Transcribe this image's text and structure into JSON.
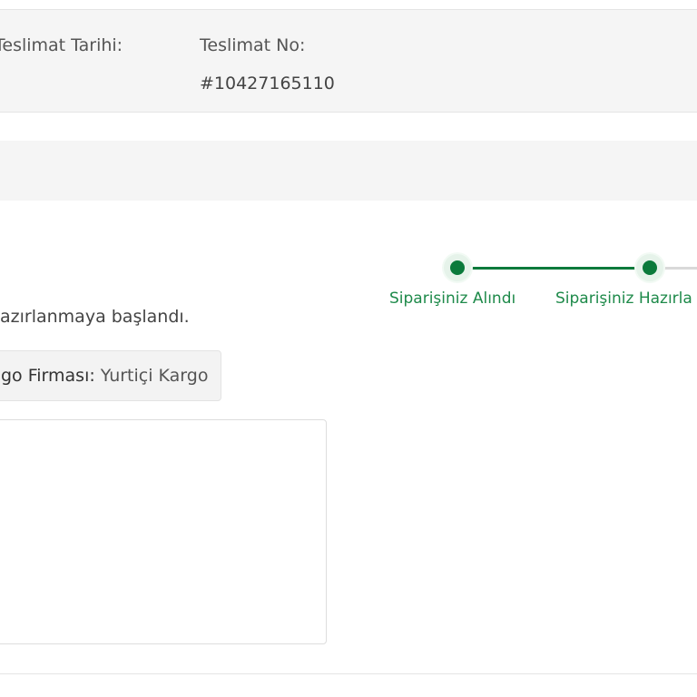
{
  "info_bar": {
    "delivery_date_label": "Teslimat Tarihi:",
    "delivery_no_label": "Teslimat No:",
    "delivery_no_value": "#10427165110"
  },
  "status": {
    "text": "azırlanmaya başlandı."
  },
  "cargo": {
    "label": "go Firması:",
    "value": "Yurtiçi Kargo"
  },
  "tracker": {
    "steps": [
      {
        "label": "Siparişiniz Alındı",
        "completed": true
      },
      {
        "label": "Siparişiniz Hazırla",
        "completed": true
      }
    ],
    "color": "#0b7a3b"
  }
}
